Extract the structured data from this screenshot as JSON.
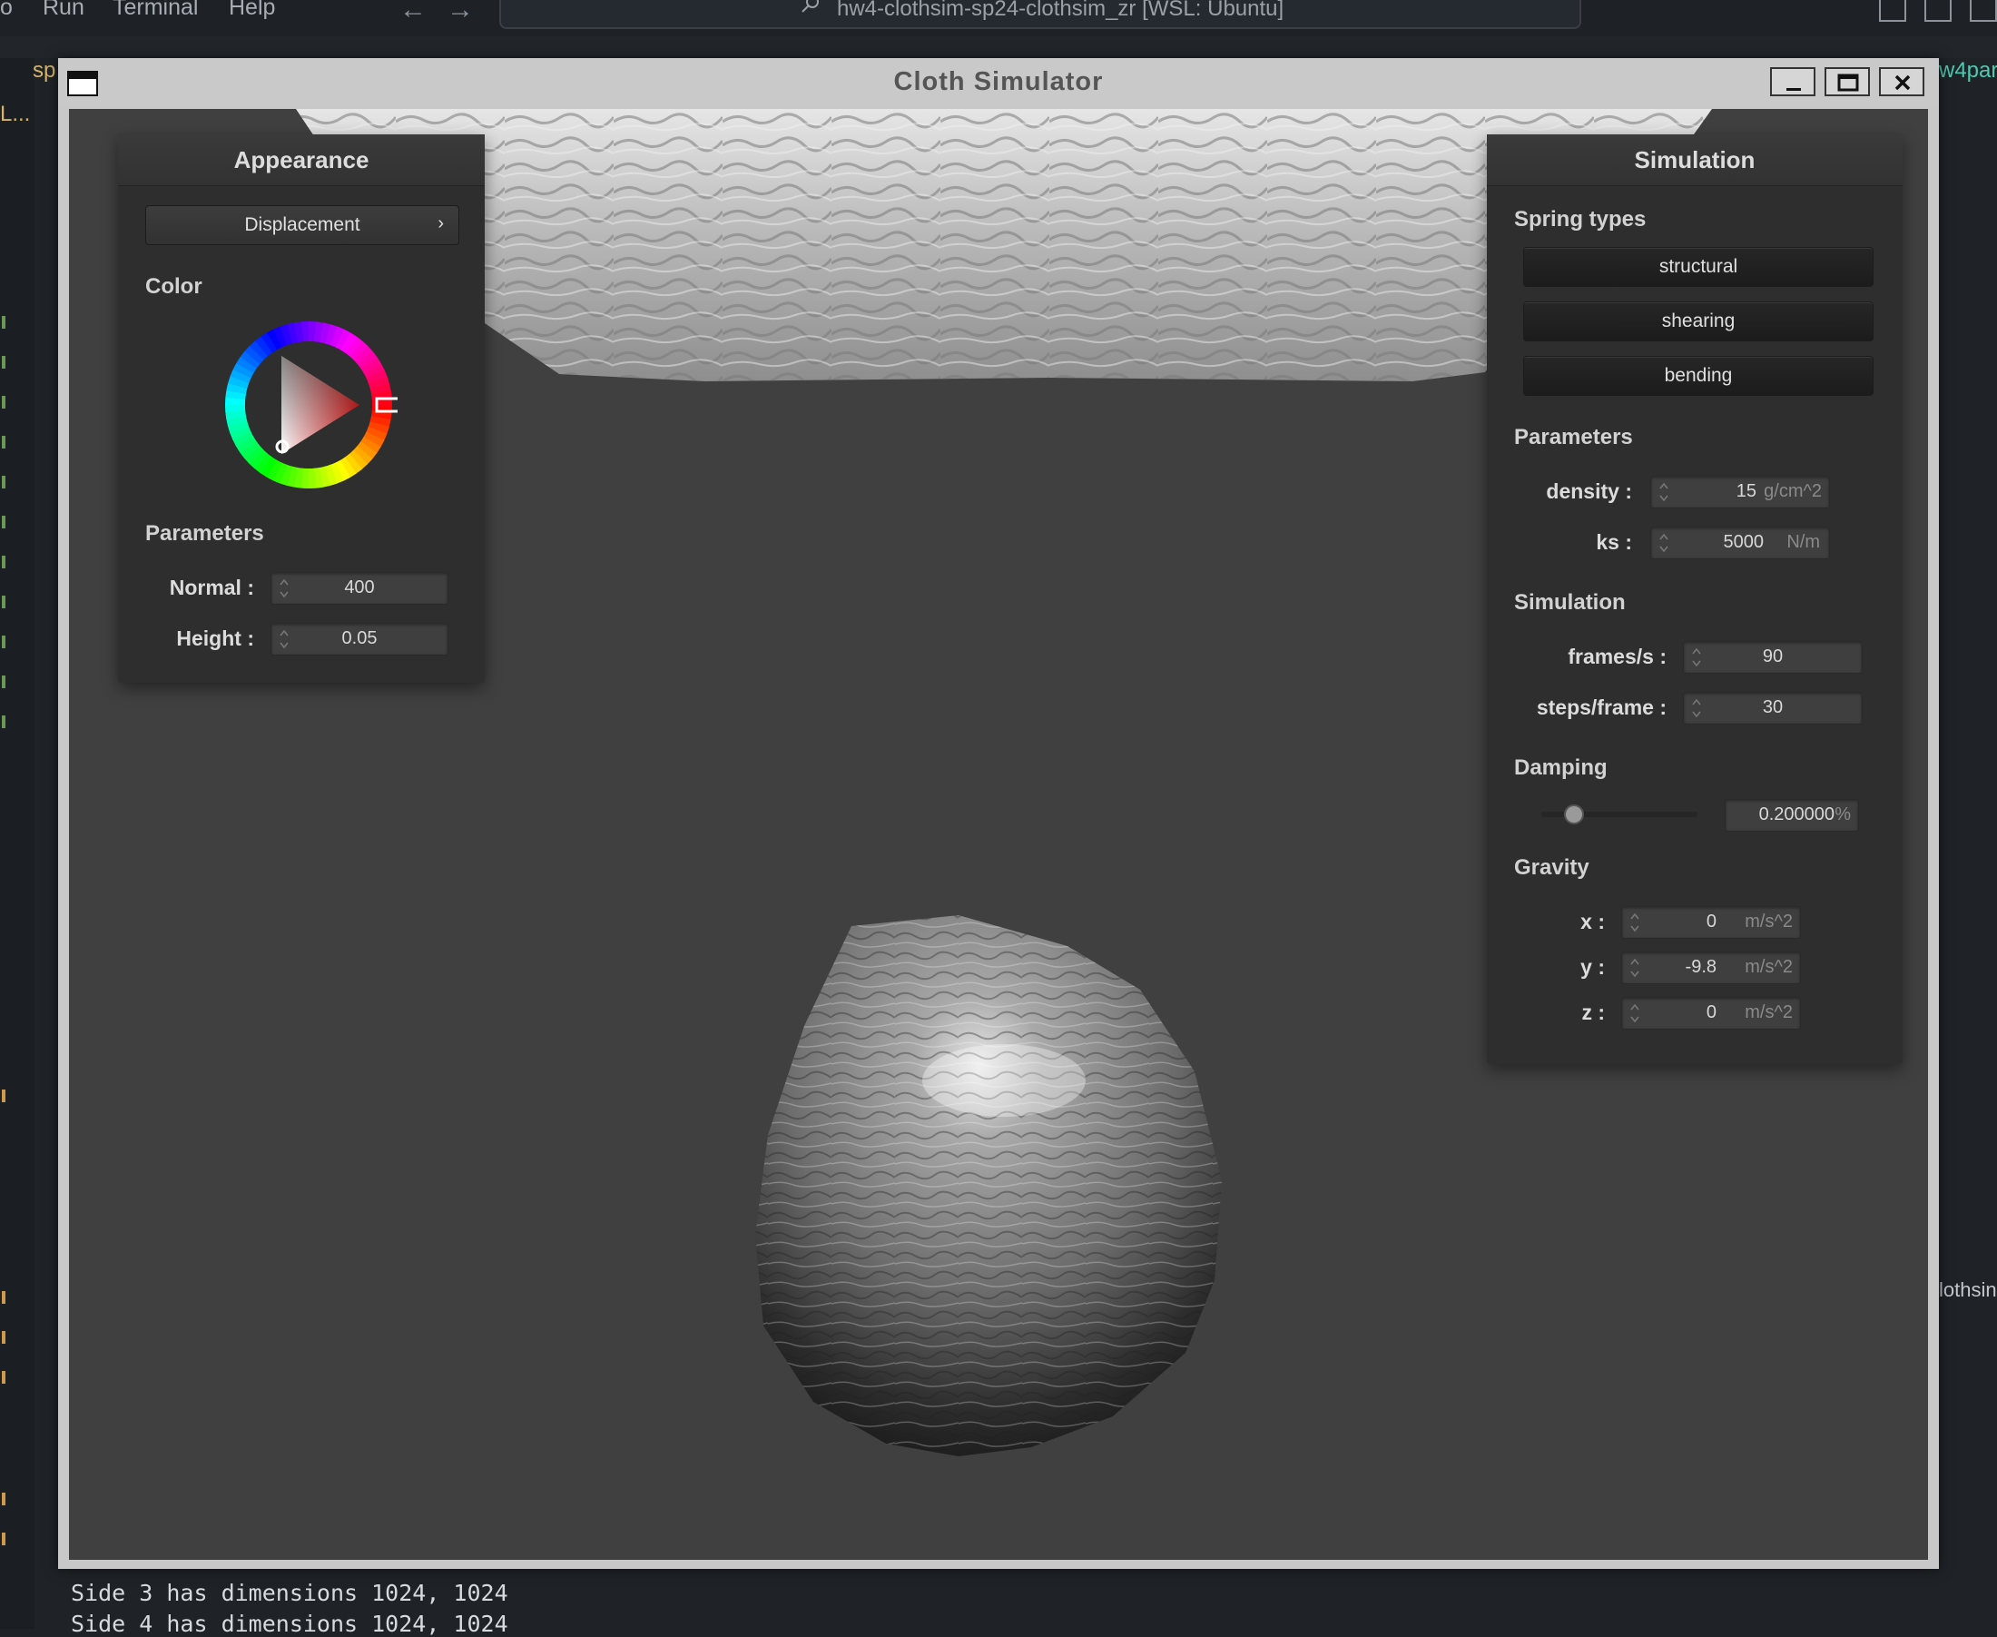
{
  "vscode": {
    "menu": [
      "o",
      "Run",
      "Terminal",
      "Help"
    ],
    "nav_back": "←",
    "nav_forward": "→",
    "search_text": "hw4-clothsim-sp24-clothsim_zr [WSL: Ubuntu]",
    "side_left_1": "sp",
    "side_left_2": "L...",
    "side_right_1": "w4par",
    "side_right_2": "lothsin",
    "terminal_lines": [
      "Side 3 has dimensions 1024, 1024",
      "Side 4 has dimensions 1024, 1024"
    ],
    "colors": {
      "accent_green": "#4ec9b0",
      "marker_orange": "#d19a4a",
      "marker_green": "#6a9955"
    }
  },
  "window": {
    "title": "Cloth Simulator",
    "controls": [
      "minimize-icon",
      "maximize-icon",
      "close-icon"
    ]
  },
  "appearance": {
    "title": "Appearance",
    "shader_button": "Displacement",
    "shader_chevron": "›",
    "color_label": "Color",
    "params_label": "Parameters",
    "normal_label": "Normal :",
    "normal_value": "400",
    "height_label": "Height :",
    "height_value": "0.05",
    "selected_color": "#d83030"
  },
  "simulation": {
    "title": "Simulation",
    "spring_types_label": "Spring types",
    "spring_buttons": [
      "structural",
      "shearing",
      "bending"
    ],
    "parameters_label": "Parameters",
    "density_label": "density :",
    "density_value": "15",
    "density_unit": "g/cm^2",
    "ks_label": "ks :",
    "ks_value": "5000",
    "ks_unit": "N/m",
    "simulation_label": "Simulation",
    "fps_label": "frames/s :",
    "fps_value": "90",
    "steps_label": "steps/frame :",
    "steps_value": "30",
    "damping_label": "Damping",
    "damping_value": "0.200000",
    "damping_unit": "%",
    "damping_fraction": 0.2,
    "gravity_label": "Gravity",
    "gx_label": "x :",
    "gx_value": "0",
    "gy_label": "y :",
    "gy_value": "-9.8",
    "gz_label": "z :",
    "gz_value": "0",
    "gravity_unit": "m/s^2"
  }
}
